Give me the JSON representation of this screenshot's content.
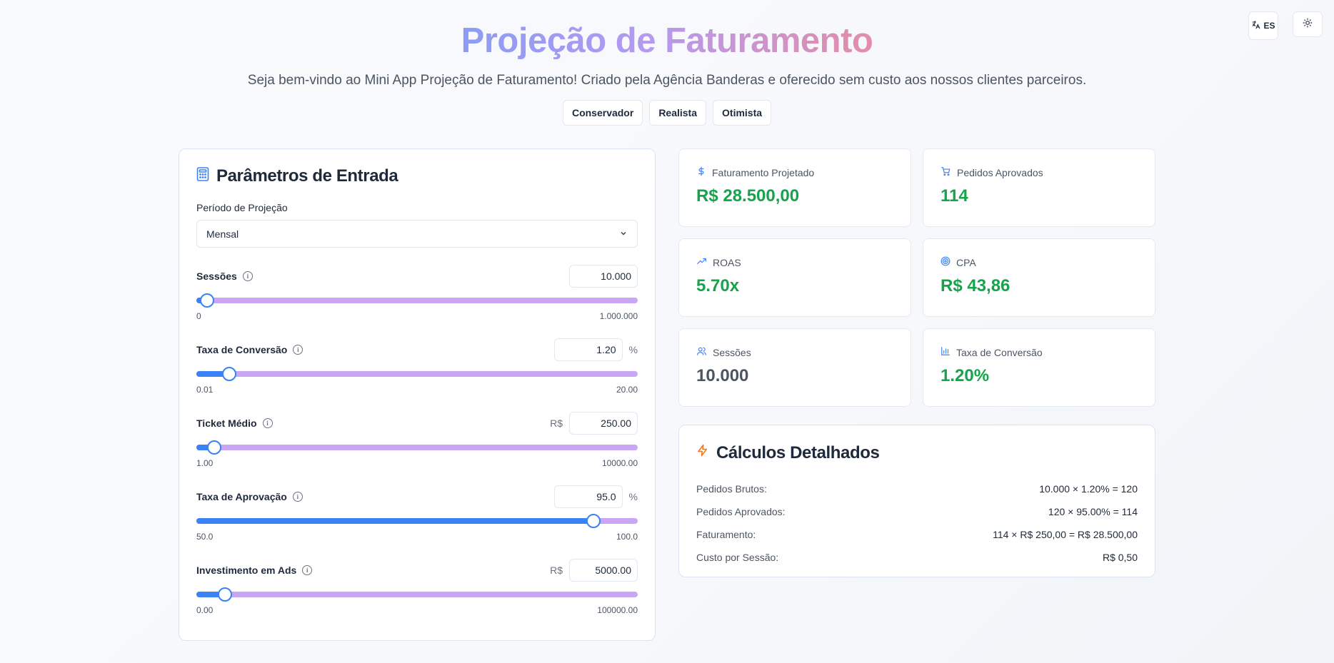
{
  "top_controls": {
    "language_label": "ES"
  },
  "header": {
    "title": "Projeção de Faturamento",
    "subtitle": "Seja bem-vindo ao Mini App Projeção de Faturamento! Criado pela Agência Banderas e oferecido sem custo aos nossos clientes parceiros.",
    "scenarios": [
      "Conservador",
      "Realista",
      "Otimista"
    ]
  },
  "inputs": {
    "title": "Parâmetros de Entrada",
    "period": {
      "label": "Período de Projeção",
      "value": "Mensal"
    },
    "params": [
      {
        "label": "Sessões",
        "prefix": "",
        "suffix": "",
        "value": "10.000",
        "min": "0",
        "max": "1.000.000",
        "level": 0.025
      },
      {
        "label": "Taxa de Conversão",
        "prefix": "",
        "suffix": "%",
        "value": "1.20",
        "min": "0.01",
        "max": "20.00",
        "level": 0.075
      },
      {
        "label": "Ticket Médio",
        "prefix": "R$",
        "suffix": "",
        "value": "250.00",
        "min": "1.00",
        "max": "10000.00",
        "level": 0.04
      },
      {
        "label": "Taxa de Aprovação",
        "prefix": "",
        "suffix": "%",
        "value": "95.0",
        "min": "50.0",
        "max": "100.0",
        "level": 0.9
      },
      {
        "label": "Investimento em Ads",
        "prefix": "R$",
        "suffix": "",
        "value": "5000.00",
        "min": "0.00",
        "max": "100000.00",
        "level": 0.065
      }
    ]
  },
  "metrics": [
    {
      "label": "Faturamento Projetado",
      "value": "R$ 28.500,00",
      "icon": "dollar-icon",
      "tone": "green"
    },
    {
      "label": "Pedidos Aprovados",
      "value": "114",
      "icon": "cart-icon",
      "tone": "green"
    },
    {
      "label": "ROAS",
      "value": "5.70x",
      "icon": "trending-up-icon",
      "tone": "green"
    },
    {
      "label": "CPA",
      "value": "R$ 43,86",
      "icon": "target-icon",
      "tone": "green"
    },
    {
      "label": "Sessões",
      "value": "10.000",
      "icon": "users-icon",
      "tone": "gray"
    },
    {
      "label": "Taxa de Conversão",
      "value": "1.20%",
      "icon": "bar-chart-icon",
      "tone": "green"
    }
  ],
  "calculations": {
    "title": "Cálculos Detalhados",
    "rows": [
      {
        "label": "Pedidos Brutos:",
        "value": "10.000 × 1.20% = 120"
      },
      {
        "label": "Pedidos Aprovados:",
        "value": "120 × 95.00% = 114"
      },
      {
        "label": "Faturamento:",
        "value": "114 × R$ 250,00 = R$ 28.500,00"
      },
      {
        "label": "Custo por Sessão:",
        "value": "R$ 0,50"
      }
    ]
  },
  "colors": {
    "accent": "#3b82f6",
    "track": "#c9a6f3",
    "positive": "#16a34a",
    "neutral": "#4b5563",
    "bolt": "#f97316"
  }
}
